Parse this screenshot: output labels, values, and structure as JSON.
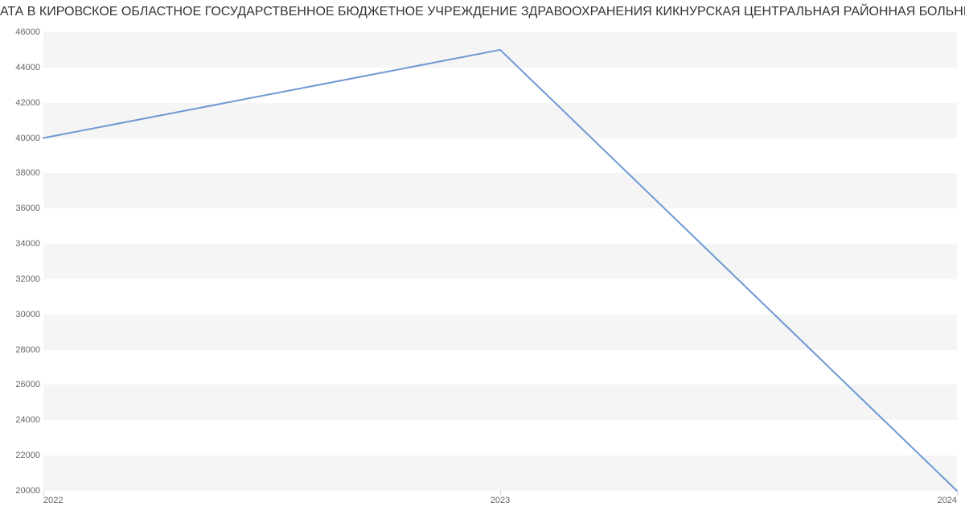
{
  "chart_data": {
    "type": "line",
    "title": "АТА В КИРОВСКОЕ ОБЛАСТНОЕ ГОСУДАРСТВЕННОЕ БЮДЖЕТНОЕ УЧРЕЖДЕНИЕ ЗДРАВООХРАНЕНИЯ КИКНУРСКАЯ ЦЕНТРАЛЬНАЯ РАЙОННАЯ БОЛЬНИЦА | Данные mnogo",
    "x": [
      2022,
      2023,
      2024
    ],
    "values": [
      40000,
      45000,
      20000
    ],
    "xlabel": "",
    "ylabel": "",
    "ylim": [
      20000,
      46000
    ],
    "xlim": [
      2022,
      2024
    ],
    "y_ticks": [
      20000,
      22000,
      24000,
      26000,
      28000,
      30000,
      32000,
      34000,
      36000,
      38000,
      40000,
      42000,
      44000,
      46000
    ],
    "x_ticks": [
      2022,
      2023,
      2024
    ],
    "line_color": "#6d99d2"
  }
}
